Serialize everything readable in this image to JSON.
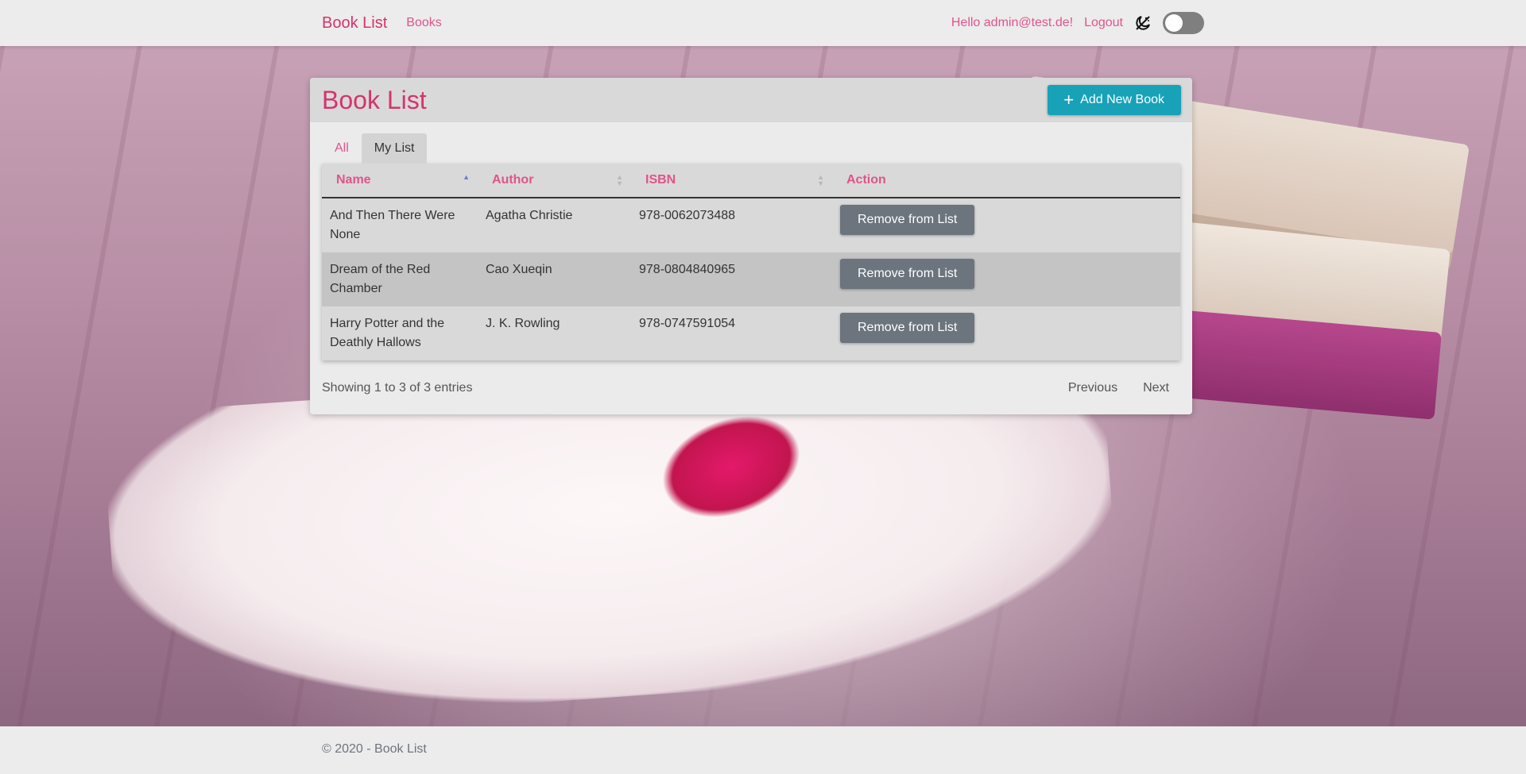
{
  "navbar": {
    "brand": "Book List",
    "links": [
      {
        "label": "Books"
      }
    ],
    "greeting": "Hello admin@test.de!",
    "logout": "Logout",
    "theme_icon": "moon-off-icon",
    "dark_mode_on": false
  },
  "card": {
    "title": "Book List",
    "add_button": "Add New Book",
    "add_icon": "plus-icon",
    "tabs": [
      {
        "label": "All",
        "active": false
      },
      {
        "label": "My List",
        "active": true
      }
    ],
    "table": {
      "columns": [
        {
          "label": "Name",
          "sort": "asc"
        },
        {
          "label": "Author",
          "sort": "none"
        },
        {
          "label": "ISBN",
          "sort": "none"
        },
        {
          "label": "Action",
          "sort": null
        }
      ],
      "rows": [
        {
          "name": "And Then There Were None",
          "author": "Agatha Christie",
          "isbn": "978-0062073488",
          "action": "Remove from List"
        },
        {
          "name": "Dream of the Red Chamber",
          "author": "Cao Xueqin",
          "isbn": "978-0804840965",
          "action": "Remove from List"
        },
        {
          "name": "Harry Potter and the Deathly Hallows",
          "author": "J. K. Rowling",
          "isbn": "978-0747591054",
          "action": "Remove from List"
        }
      ]
    },
    "info": "Showing 1 to 3 of 3 entries",
    "pagination": {
      "previous": "Previous",
      "next": "Next"
    }
  },
  "footer": {
    "text": "© 2020 - Book List"
  },
  "colors": {
    "accent": "#d6336c",
    "link": "#e0548a",
    "primary_button": "#17a2b8",
    "secondary_button": "#6c757d"
  }
}
